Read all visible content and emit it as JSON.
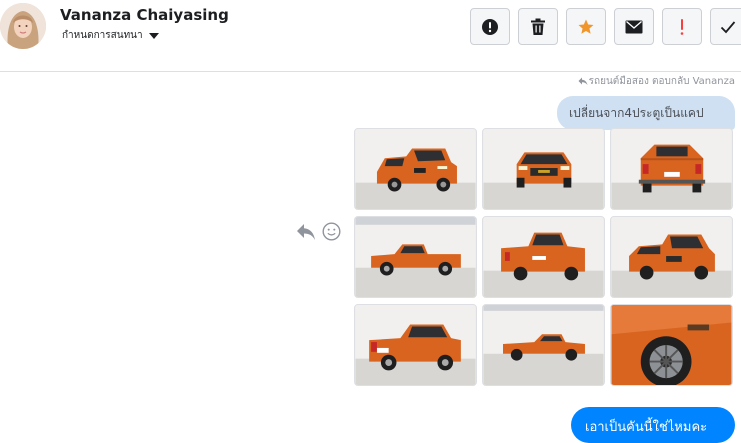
{
  "header": {
    "contact_name": "Vananza Chaiyasing",
    "conversation_settings": "กำหนดการสนทนา"
  },
  "toolbar": {
    "buttons": [
      {
        "name": "alert-button",
        "icon": "exclamation-circle-icon"
      },
      {
        "name": "delete-button",
        "icon": "trash-icon"
      },
      {
        "name": "star-button",
        "icon": "star-icon",
        "color": "#f0962b"
      },
      {
        "name": "mail-button",
        "icon": "envelope-icon"
      },
      {
        "name": "spam-button",
        "icon": "exclamation-icon",
        "color": "#fa3e3e"
      },
      {
        "name": "done-button",
        "icon": "check-icon"
      }
    ]
  },
  "thread": {
    "reply_note": "รถยนต์มือสอง ตอบกลับ Vananza",
    "quoted_message": "เปลี่ยนจาก4ประตูเป็นแคป",
    "photo_count": 9,
    "photo_subject": "orange pickup truck",
    "outgoing_message": "เอาเป็นคันนี้ใช่ไหมคะ"
  },
  "colors": {
    "accent_blue": "#0084ff",
    "quoted_bubble": "#cfe0f3",
    "truck_orange": "#d9641f"
  }
}
